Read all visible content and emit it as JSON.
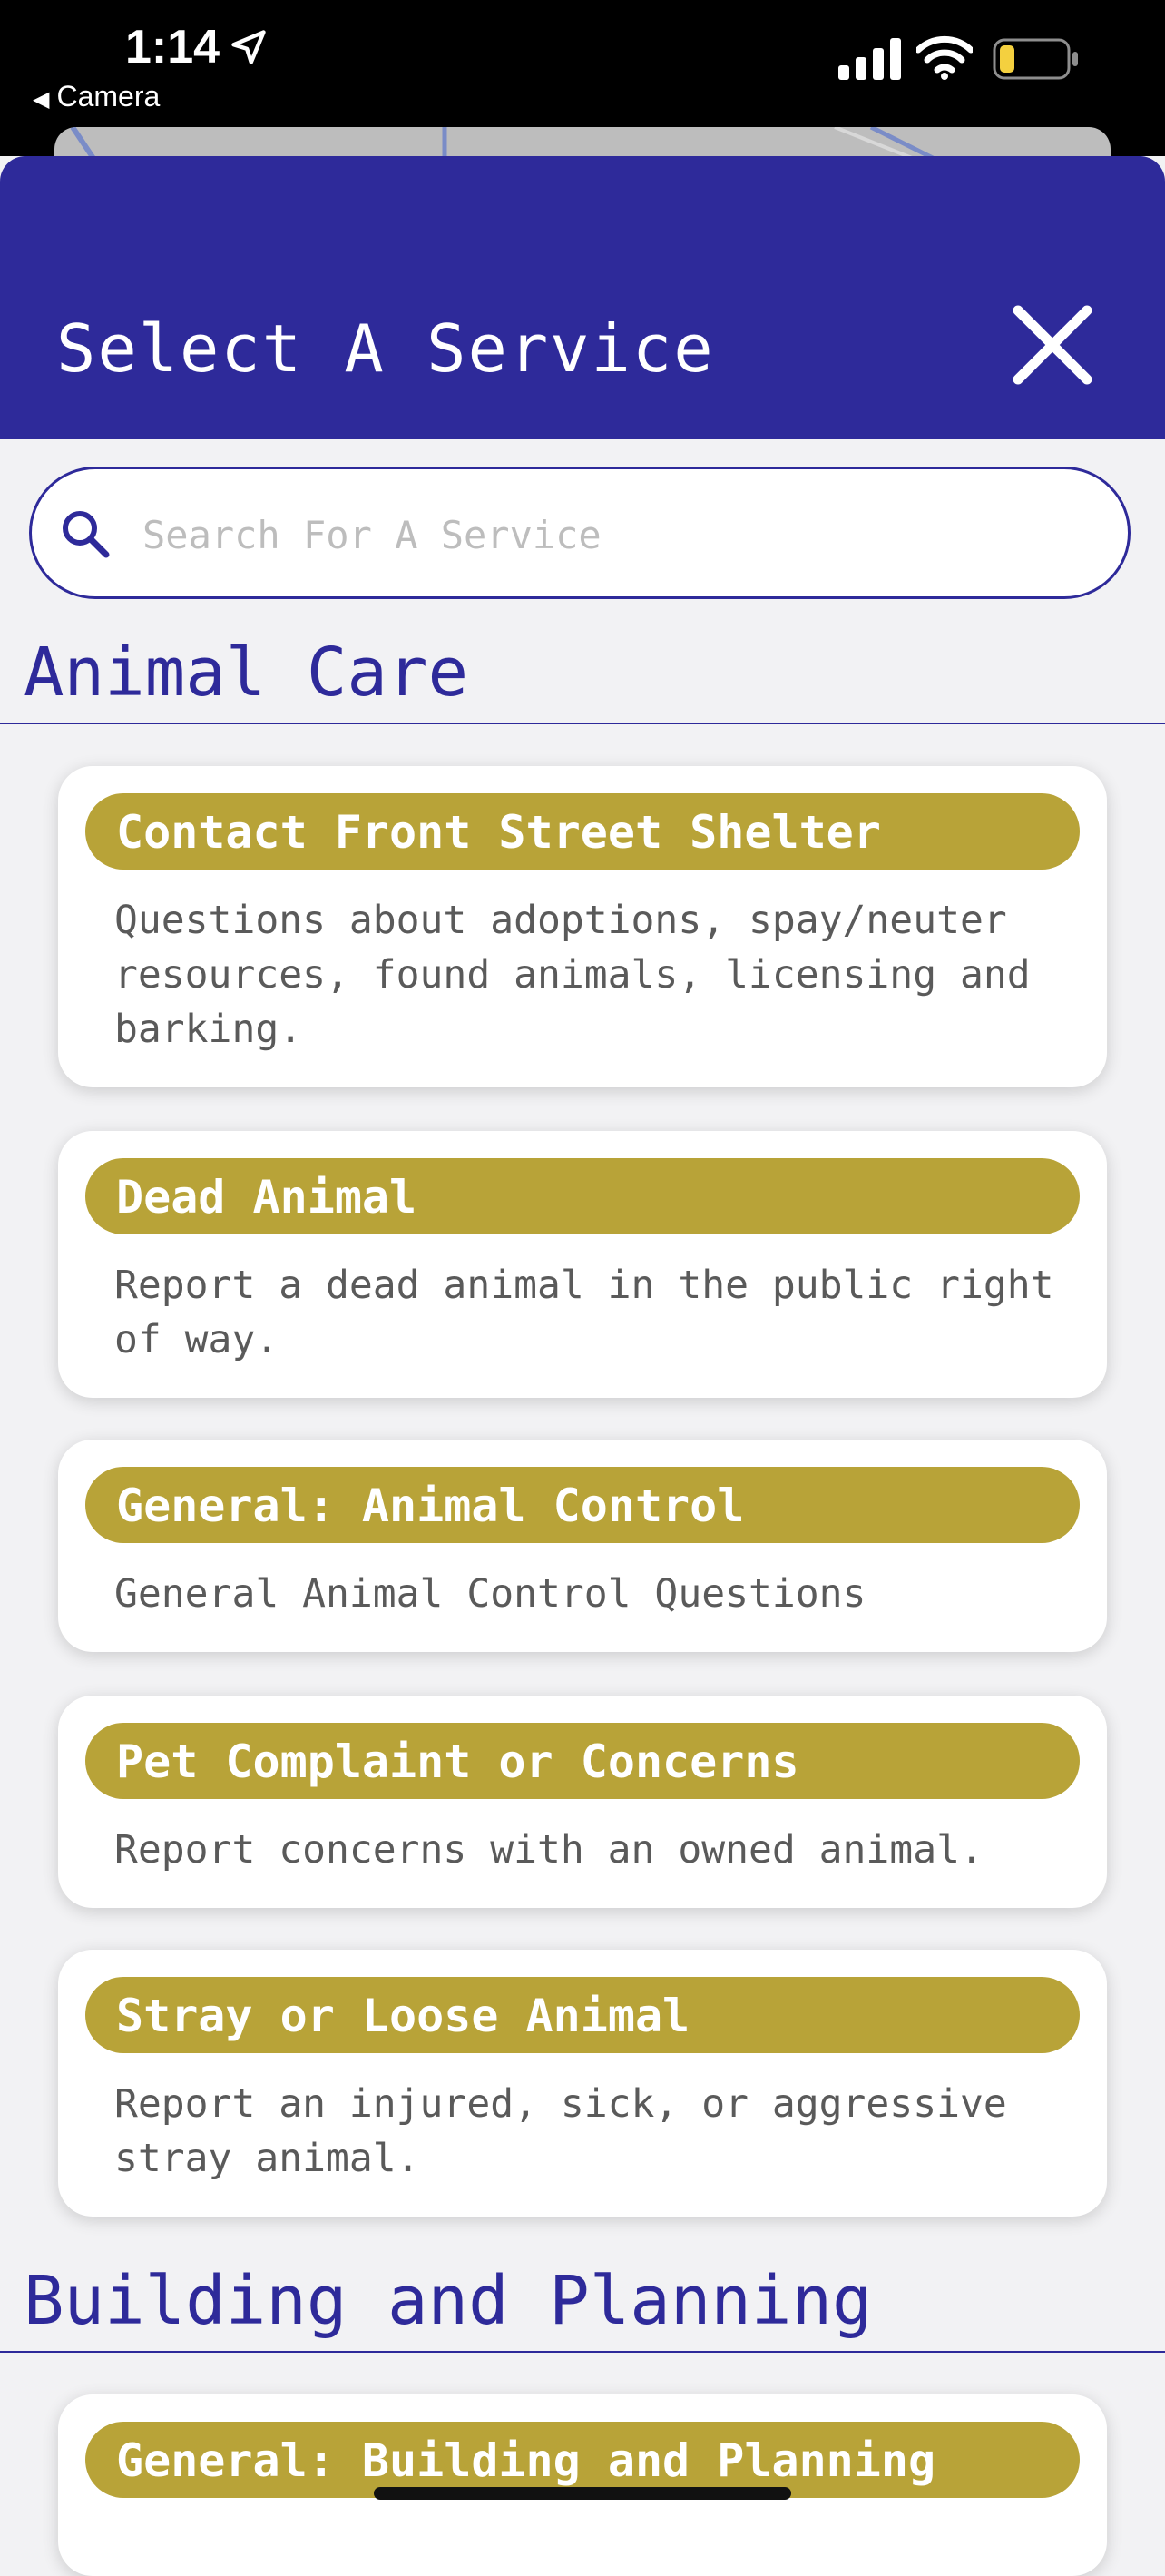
{
  "status_bar": {
    "time": "1:14",
    "back_app": "Camera"
  },
  "header": {
    "title": "Select A Service"
  },
  "search": {
    "placeholder": "Search For A Service",
    "value": ""
  },
  "sections": [
    {
      "title": "Animal Care",
      "items": [
        {
          "title": "Contact Front Street Shelter",
          "description": "Questions about adoptions, spay/neuter resources, found animals, licensing and barking."
        },
        {
          "title": "Dead Animal",
          "description": "Report a dead animal in the public right of way."
        },
        {
          "title": "General: Animal Control",
          "description": "General Animal Control Questions"
        },
        {
          "title": "Pet Complaint or Concerns",
          "description": "Report concerns with an owned animal."
        },
        {
          "title": "Stray or Loose Animal",
          "description": "Report an injured, sick, or aggressive stray animal."
        }
      ]
    },
    {
      "title": "Building and Planning",
      "items": [
        {
          "title": "General: Building and Planning",
          "description": ""
        }
      ]
    }
  ],
  "colors": {
    "header_bg": "#2e2a9a",
    "pill_bg": "#b8a338",
    "page_bg": "#f2f2f4"
  },
  "icons": {
    "close": "close-icon",
    "search": "search-icon",
    "location": "location-arrow-icon"
  }
}
